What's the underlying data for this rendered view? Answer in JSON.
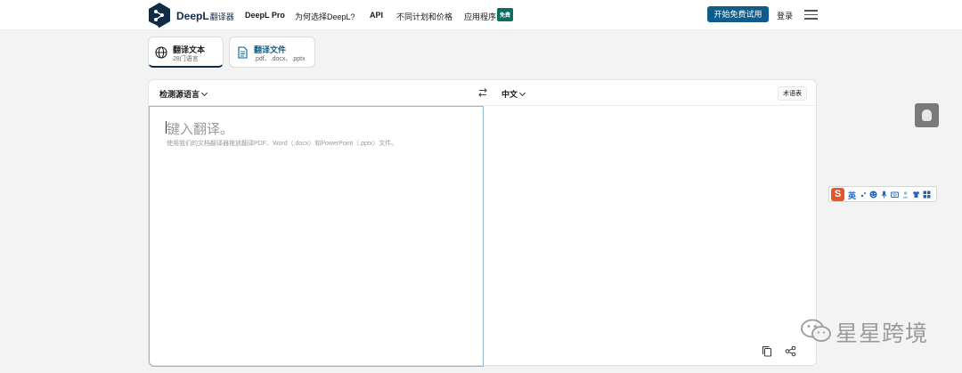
{
  "header": {
    "brand": "DeepL",
    "brand_sub": "翻译器",
    "nav": [
      "DeepL Pro",
      "为何选择DeepL?",
      "API",
      "不同计划和价格",
      "应用程序"
    ],
    "badge": "免费",
    "cta": "开始免费试用",
    "login": "登录"
  },
  "modes": [
    {
      "title": "翻译文本",
      "subtitle": "28门语言",
      "icon": "globe-icon"
    },
    {
      "title": "翻译文件",
      "subtitle": ".pdf、.docx、.pptx",
      "icon": "document-icon"
    }
  ],
  "translator": {
    "source_lang": "检测源语言",
    "target_lang": "中文",
    "glossary": "术语表",
    "placeholder": "键入翻译。",
    "hint": "使用我们的文档翻译器拖放翻译PDF、Word（.docx）和PowerPoint（.pptx）文件。",
    "icons": [
      "swap-icon",
      "copy-icon",
      "share-icon"
    ]
  },
  "ime": {
    "logo": "S",
    "mode": "英",
    "icons": [
      "punctuation-icon",
      "emoji-icon",
      "mic-icon",
      "keyboard-icon",
      "user-icon",
      "skin-icon",
      "grid-icon"
    ]
  },
  "watermark": {
    "text": "星星跨境"
  },
  "colors": {
    "brand": "#0f2b46",
    "cta": "#0f5c8a",
    "badge": "#0a6e61",
    "ime_logo": "#e8542a"
  }
}
